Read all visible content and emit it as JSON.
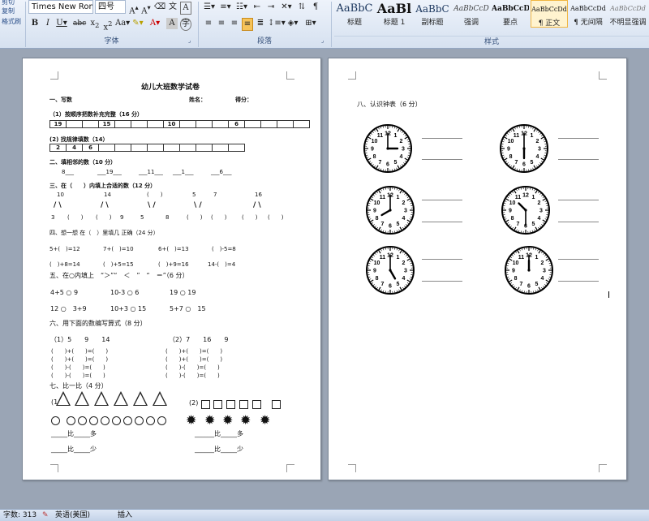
{
  "ribbon": {
    "clipboard": {
      "cut": "剪切",
      "copy": "复制",
      "format_painter": "格式刷"
    },
    "font": {
      "name": "Times New Roman",
      "size": "四号",
      "group_label": "字体"
    },
    "paragraph": {
      "group_label": "段落"
    },
    "styles": {
      "group_label": "样式",
      "tiles": [
        {
          "preview": "AaBbC",
          "name": "标题"
        },
        {
          "preview": "AaBl",
          "name": "标题 1"
        },
        {
          "preview": "AaBbC",
          "name": "副标题"
        },
        {
          "preview": "AaBbCcD",
          "name": "强调"
        },
        {
          "preview": "AaBbCcD",
          "name": "要点"
        },
        {
          "preview": "AaBbCcDd",
          "name": "正文"
        },
        {
          "preview": "AaBbCcDd",
          "name": "无间隔"
        },
        {
          "preview": "AaBbCcDd",
          "name": "不明显强调"
        }
      ]
    }
  },
  "page1": {
    "title": "幼儿大班数学试卷",
    "s1": "一、写数",
    "name_label": "姓名：",
    "score_label": "得分：",
    "q1_label": "（1）按顺序把数补充完整（16 分）",
    "q1_cells": [
      "19",
      "",
      "",
      "15",
      "",
      "",
      "",
      "10",
      "",
      "",
      "",
      "6",
      "",
      "",
      "",
      ""
    ],
    "q2_label": "(2) 找规律填数（14）",
    "q2_cells": [
      "2",
      "4",
      "6",
      "",
      "",
      "",
      "",
      "",
      "",
      "",
      "",
      ""
    ],
    "s2": "二、填相邻的数（10 分）",
    "s2_items": [
      "8___",
      "___19___",
      "___11___",
      "___1___",
      "___6___"
    ],
    "s3": "三、在（　　）内填上合适的数（12 分）",
    "s3_top": [
      "10",
      "14",
      "(　　)",
      "5",
      "7",
      "16"
    ],
    "s3_slashes": [
      "/ \\",
      "/ \\",
      "\\ /",
      "\\ /",
      "/ \\"
    ],
    "s3_bottom": [
      "3",
      "(　　)",
      "(　　)",
      "9",
      "5",
      "8",
      "(　　)",
      "(　　)",
      "(　　)",
      "(　　)"
    ],
    "s4": "四、想一想 在（　）里填几 正确（24 分）",
    "s4_row1": [
      "5+(　)=12",
      "7+(　)=10",
      "6+(　)=13",
      "(　)-5=8"
    ],
    "s4_row2": [
      "(　)+8=14",
      "(　)+5=15",
      "(　)+9=16",
      "14-(　)=4"
    ],
    "s5": "五、在○内填上　“＞”“　＜　”　“　＝”（6 分）",
    "s5_row1": [
      "4+5 ○ 9",
      "10-3 ○ 6",
      "19 ○ 19"
    ],
    "s5_row2": [
      "12 ○　3+9",
      "10+3 ○ 15",
      "5+7 ○　15"
    ],
    "s6": "六、用下面的数编写算式（8 分）",
    "s6_left_nums": "（1）5　　9　　14",
    "s6_right_nums": "（2）7　　16　　9",
    "s6_eq_plus": "(　　)+(　　)=(　　)",
    "s6_eq_minus": "(　　)-(　　)=(　　)",
    "s7": "七、比一比（4 分）",
    "s7_left_num": "(1",
    "s7_right_num": "(2)",
    "s7_left_more": "_____比_____多",
    "s7_left_less": "_____比_____少",
    "s7_right_more": "______比_____多",
    "s7_right_less": "______比_____少"
  },
  "page2": {
    "heading": "八、认识钟表（6 分）",
    "clocks": [
      {
        "hour": 3,
        "minute": 0
      },
      {
        "hour": 6,
        "minute": 0
      },
      {
        "hour": 8,
        "minute": 0
      },
      {
        "hour": 10,
        "minute": 30
      },
      {
        "hour": 5,
        "minute": 0
      },
      {
        "hour": 12,
        "minute": 0
      }
    ]
  },
  "status": {
    "word_count": "字数: 313",
    "language": "英语(美国)",
    "mode": "插入"
  }
}
